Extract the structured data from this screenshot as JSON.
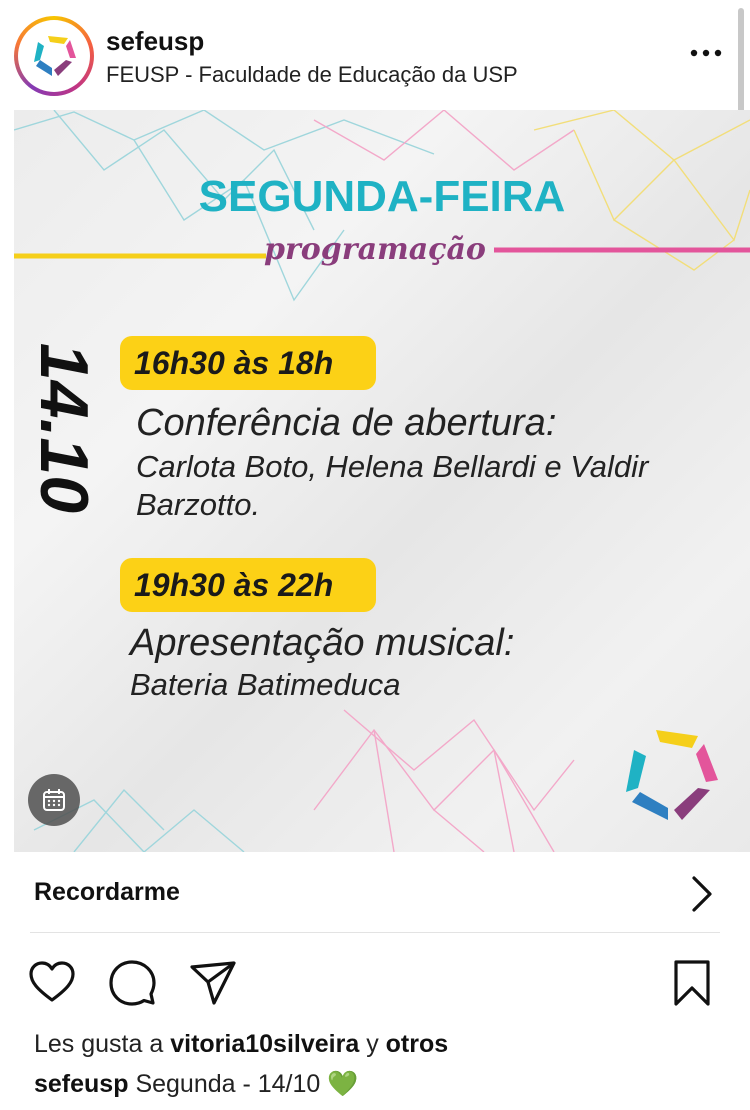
{
  "header": {
    "username": "sefeusp",
    "subtitle": "FEUSP - Faculdade de Educação da USP"
  },
  "post": {
    "title": "SEGUNDA-FEIRA",
    "subtitle": "programação",
    "date": "14.10",
    "events": [
      {
        "time": "16h30 às 18h",
        "title": "Conferência de abertura:",
        "names": "Carlota Boto, Helena Bellardi e Valdir Barzotto."
      },
      {
        "time": "19h30 às 22h",
        "title": "Apresentação musical:",
        "names": "Bateria Batimeduca"
      }
    ]
  },
  "reminder": {
    "label": "Recordarme"
  },
  "likes": {
    "prefix": "Les gusta a",
    "user": "vitoria10silveira",
    "middle": "y",
    "suffix": "otros"
  },
  "caption": {
    "user": "sefeusp",
    "text": "Segunda - 14/10",
    "emoji": "💚"
  },
  "colors": {
    "title_cyan": "#1fb2c4",
    "badge_yellow": "#fcd116",
    "subtitle_purple": "#8a3d7c",
    "line_yellow": "#f5cf1a",
    "line_pink": "#e3559b"
  },
  "icons": [
    "more-options-icon",
    "calendar-icon",
    "chevron-right-icon",
    "heart-icon",
    "comment-icon",
    "share-icon",
    "bookmark-icon"
  ]
}
